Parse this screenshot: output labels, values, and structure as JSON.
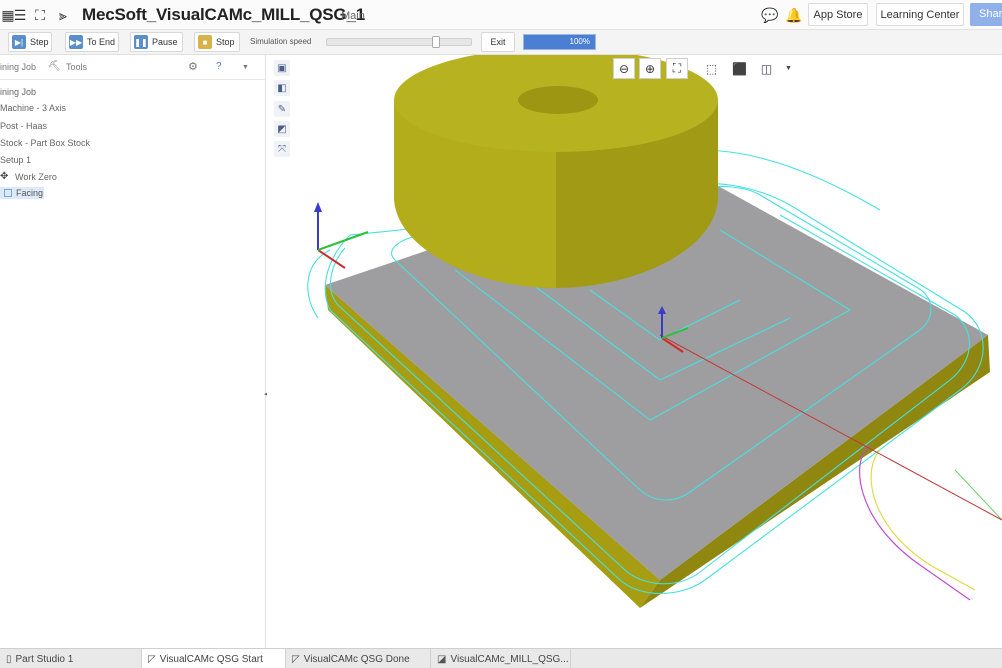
{
  "header": {
    "title": "MecSoft_VisualCAMc_MILL_QSG_1",
    "branch": "Main",
    "app_store_label": "App Store",
    "learning_center_label": "Learning Center",
    "share_label": "Share"
  },
  "sim_toolbar": {
    "step_label": "Step",
    "to_end_label": "To End",
    "pause_label": "Pause",
    "stop_label": "Stop",
    "speed_label": "Simulation speed",
    "speed_level": 0.77,
    "exit_label": "Exit",
    "progress_text": "100%",
    "progress_value": 1.0
  },
  "left_panel": {
    "tabs": [
      "ining Job",
      "Tools"
    ],
    "tree": [
      "ining Job",
      "Machine - 3 Axis",
      "Post - Haas",
      "Stock - Part Box Stock",
      "Setup 1",
      "Work Zero",
      "Facing"
    ]
  },
  "bottom_tabs": [
    "Part Studio 1",
    "VisualCAMc QSG Start",
    "VisualCAMc QSG Done",
    "VisualCAMc_MILL_QSG..."
  ],
  "colors": {
    "tool_yellow": "#a9a214",
    "stock_side": "#a39a10",
    "stock_top": "#9e9ea0",
    "toolpath_cyan": "#46e0e0",
    "accent_blue": "#4a7fd4"
  }
}
